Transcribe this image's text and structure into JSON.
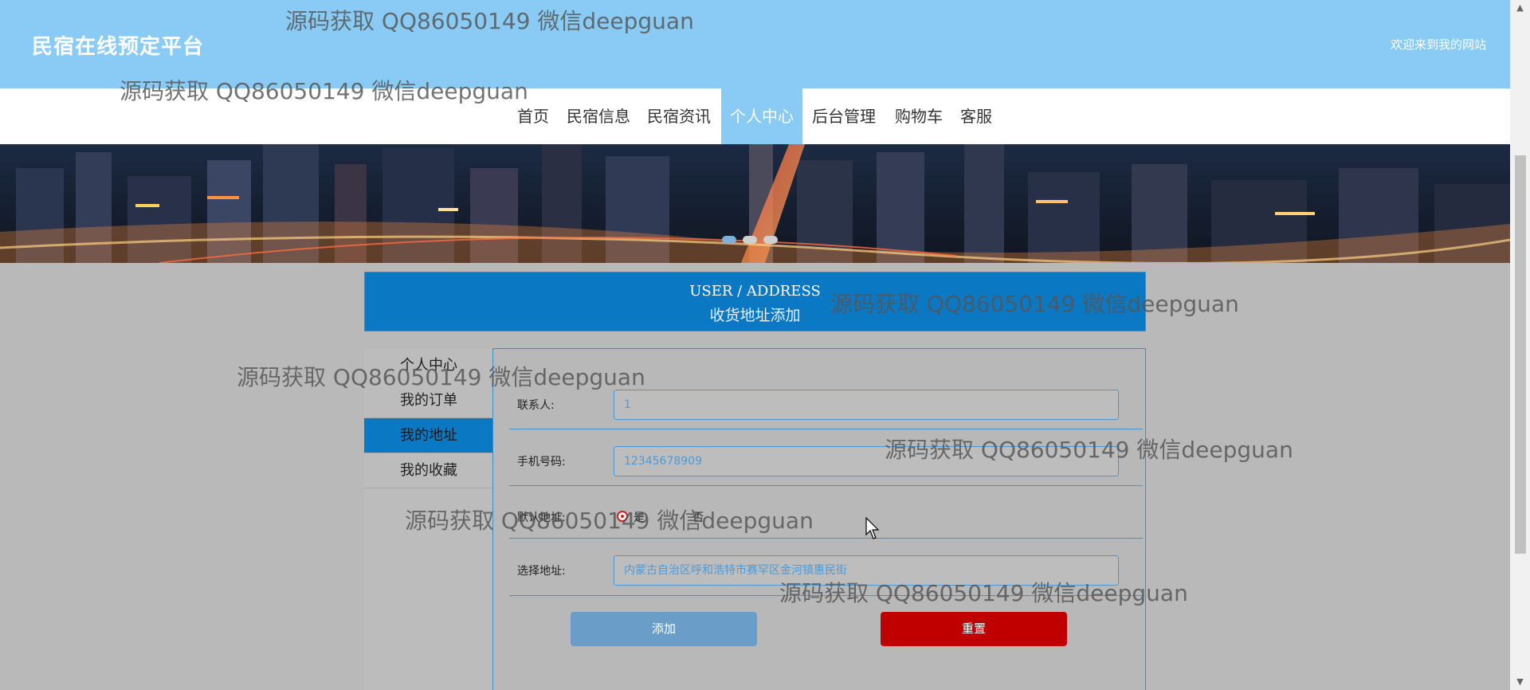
{
  "header": {
    "site_title": "民宿在线预定平台",
    "welcome_text": "欢迎来到我的网站"
  },
  "nav": {
    "items": [
      {
        "label": "首页",
        "active": false
      },
      {
        "label": "民宿信息",
        "active": false
      },
      {
        "label": "民宿资讯",
        "active": false
      },
      {
        "label": "个人中心",
        "active": true
      },
      {
        "label": "后台管理",
        "active": false
      },
      {
        "label": "购物车",
        "active": false
      },
      {
        "label": "客服",
        "active": false
      }
    ]
  },
  "banner": {
    "slide_count": 3,
    "active_slide": 1
  },
  "section_header": {
    "title_en": "USER / ADDRESS",
    "title_cn": "收货地址添加"
  },
  "sidebar": {
    "items": [
      {
        "label": "个人中心",
        "active": false
      },
      {
        "label": "我的订单",
        "active": false
      },
      {
        "label": "我的地址",
        "active": true
      },
      {
        "label": "我的收藏",
        "active": false
      }
    ]
  },
  "form": {
    "contact_label": "联系人:",
    "contact_value": "1",
    "phone_label": "手机号码:",
    "phone_value": "12345678909",
    "default_label": "默认地址:",
    "default_yes": "是",
    "default_no": "否",
    "address_label": "选择地址:",
    "address_value": "内蒙古自治区呼和浩特市赛罕区金河镇惠民街",
    "add_button": "添加",
    "reset_button": "重置"
  },
  "watermark": {
    "text": "源码获取 QQ86050149 微信deepguan"
  },
  "colors": {
    "topbar": "#89cbf5",
    "accent_blue": "#0b78c4",
    "reset_red": "#c00000",
    "add_button": "#6a9ec8"
  }
}
